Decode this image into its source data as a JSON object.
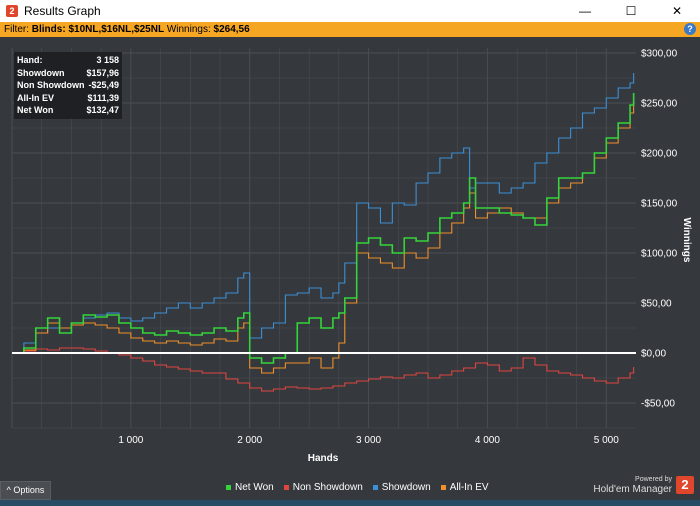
{
  "window": {
    "title": "Results Graph",
    "app_icon_glyph": "2",
    "minimize_glyph": "—",
    "maximize_glyph": "☐",
    "close_glyph": "✕"
  },
  "filter": {
    "prefix": "Filter:",
    "blinds": "Blinds: $10NL,$16NL,$25NL",
    "winnings_label": "Winnings:",
    "winnings_value": "$264,56",
    "help_glyph": "?"
  },
  "stats": [
    {
      "label": "Hand:",
      "value": "3 158"
    },
    {
      "label": "Showdown",
      "value": "$157,96"
    },
    {
      "label": "Non Showdown",
      "value": "-$25,49"
    },
    {
      "label": "All-In EV",
      "value": "$111,39"
    },
    {
      "label": "Net Won",
      "value": "$132,47"
    }
  ],
  "footer": {
    "options_label": "Options",
    "options_icon": "^",
    "powered_by": "Powered by",
    "brand": "Hold'em Manager",
    "logo_glyph": "2"
  },
  "colors": {
    "net_won": "#35d43a",
    "non_showdown": "#e0463f",
    "showdown": "#3d8fd6",
    "all_in_ev": "#f0902a",
    "zero_line": "#ffffff",
    "grid": "#4a4e54"
  },
  "chart_data": {
    "type": "line",
    "xlabel": "Hands",
    "ylabel": "Winnings",
    "xlim": [
      0,
      5250
    ],
    "ylim": [
      -75,
      305
    ],
    "x_ticks": [
      1000,
      2000,
      3000,
      4000,
      5000
    ],
    "x_tick_labels": [
      "1 000",
      "2 000",
      "3 000",
      "4 000",
      "5 000"
    ],
    "y_ticks": [
      300,
      250,
      200,
      150,
      100,
      50,
      0,
      -50
    ],
    "y_tick_labels": [
      "$300,00",
      "$250,00",
      "$200,00",
      "$150,00",
      "$100,00",
      "$50,00",
      "$0,00",
      "-$50,00"
    ],
    "legend_position": "bottom",
    "series": [
      {
        "name": "Net Won",
        "color": "#35d43a",
        "x": [
          0,
          100,
          200,
          300,
          400,
          500,
          600,
          700,
          800,
          900,
          1000,
          1100,
          1200,
          1300,
          1400,
          1500,
          1600,
          1700,
          1800,
          1900,
          1950,
          2000,
          2100,
          2200,
          2300,
          2400,
          2500,
          2600,
          2700,
          2750,
          2800,
          2900,
          3000,
          3100,
          3200,
          3300,
          3400,
          3500,
          3600,
          3700,
          3800,
          3850,
          3900,
          4000,
          4100,
          4200,
          4300,
          4400,
          4500,
          4600,
          4700,
          4800,
          4900,
          5000,
          5100,
          5200,
          5230
        ],
        "y": [
          0,
          5,
          25,
          35,
          20,
          30,
          38,
          36,
          38,
          30,
          25,
          20,
          18,
          22,
          20,
          18,
          20,
          25,
          22,
          35,
          40,
          -5,
          -10,
          -5,
          0,
          30,
          35,
          25,
          35,
          40,
          55,
          110,
          115,
          108,
          100,
          115,
          112,
          120,
          135,
          140,
          150,
          175,
          145,
          145,
          140,
          138,
          135,
          128,
          155,
          175,
          175,
          180,
          200,
          215,
          230,
          248,
          260
        ]
      },
      {
        "name": "Non Showdown",
        "color": "#e0463f",
        "x": [
          0,
          100,
          200,
          300,
          400,
          500,
          600,
          700,
          800,
          900,
          1000,
          1100,
          1200,
          1300,
          1400,
          1500,
          1600,
          1700,
          1800,
          1900,
          2000,
          2100,
          2200,
          2300,
          2400,
          2500,
          2600,
          2700,
          2800,
          2900,
          3000,
          3100,
          3200,
          3300,
          3400,
          3500,
          3600,
          3700,
          3800,
          3900,
          4000,
          4100,
          4200,
          4300,
          4400,
          4500,
          4600,
          4700,
          4800,
          4900,
          5000,
          5100,
          5200,
          5230
        ],
        "y": [
          0,
          2,
          4,
          3,
          5,
          5,
          4,
          2,
          0,
          -2,
          -5,
          -8,
          -12,
          -14,
          -16,
          -18,
          -20,
          -20,
          -26,
          -30,
          -35,
          -38,
          -36,
          -34,
          -35,
          -36,
          -35,
          -33,
          -30,
          -28,
          -26,
          -24,
          -25,
          -22,
          -20,
          -25,
          -22,
          -18,
          -15,
          -10,
          -12,
          -18,
          -15,
          -5,
          -12,
          -18,
          -20,
          -22,
          -25,
          -28,
          -30,
          -25,
          -20,
          -14
        ]
      },
      {
        "name": "Showdown",
        "color": "#3d8fd6",
        "x": [
          0,
          100,
          200,
          300,
          400,
          500,
          600,
          700,
          800,
          900,
          1000,
          1100,
          1200,
          1300,
          1400,
          1500,
          1600,
          1700,
          1800,
          1900,
          1950,
          2000,
          2100,
          2200,
          2300,
          2400,
          2500,
          2600,
          2700,
          2750,
          2800,
          2900,
          3000,
          3100,
          3200,
          3300,
          3400,
          3500,
          3600,
          3700,
          3800,
          3850,
          3900,
          4000,
          4100,
          4200,
          4300,
          4400,
          4500,
          4600,
          4700,
          4800,
          4900,
          5000,
          5100,
          5200,
          5230
        ],
        "y": [
          0,
          10,
          20,
          25,
          25,
          30,
          35,
          38,
          40,
          35,
          32,
          35,
          40,
          45,
          50,
          45,
          50,
          55,
          60,
          75,
          80,
          15,
          25,
          30,
          58,
          60,
          65,
          55,
          60,
          70,
          90,
          150,
          145,
          130,
          150,
          148,
          170,
          180,
          195,
          200,
          205,
          165,
          170,
          170,
          160,
          165,
          170,
          190,
          200,
          215,
          225,
          240,
          245,
          255,
          265,
          270,
          280
        ]
      },
      {
        "name": "All-In EV",
        "color": "#f0902a",
        "x": [
          0,
          100,
          200,
          300,
          400,
          500,
          600,
          700,
          800,
          900,
          1000,
          1100,
          1200,
          1300,
          1400,
          1500,
          1600,
          1700,
          1800,
          1900,
          1950,
          2000,
          2100,
          2200,
          2300,
          2400,
          2500,
          2600,
          2700,
          2750,
          2800,
          2900,
          3000,
          3100,
          3200,
          3300,
          3400,
          3500,
          3600,
          3700,
          3800,
          3850,
          3900,
          4000,
          4100,
          4200,
          4300,
          4400,
          4500,
          4600,
          4700,
          4800,
          4900,
          5000,
          5100,
          5200,
          5230
        ],
        "y": [
          0,
          3,
          20,
          30,
          25,
          28,
          30,
          28,
          25,
          20,
          15,
          12,
          10,
          12,
          10,
          8,
          10,
          14,
          12,
          25,
          30,
          -15,
          -20,
          -15,
          -10,
          -10,
          -5,
          -15,
          -5,
          10,
          50,
          100,
          95,
          90,
          85,
          100,
          95,
          105,
          120,
          130,
          145,
          160,
          135,
          140,
          145,
          140,
          135,
          135,
          150,
          165,
          170,
          180,
          195,
          210,
          225,
          240,
          255
        ]
      }
    ]
  }
}
